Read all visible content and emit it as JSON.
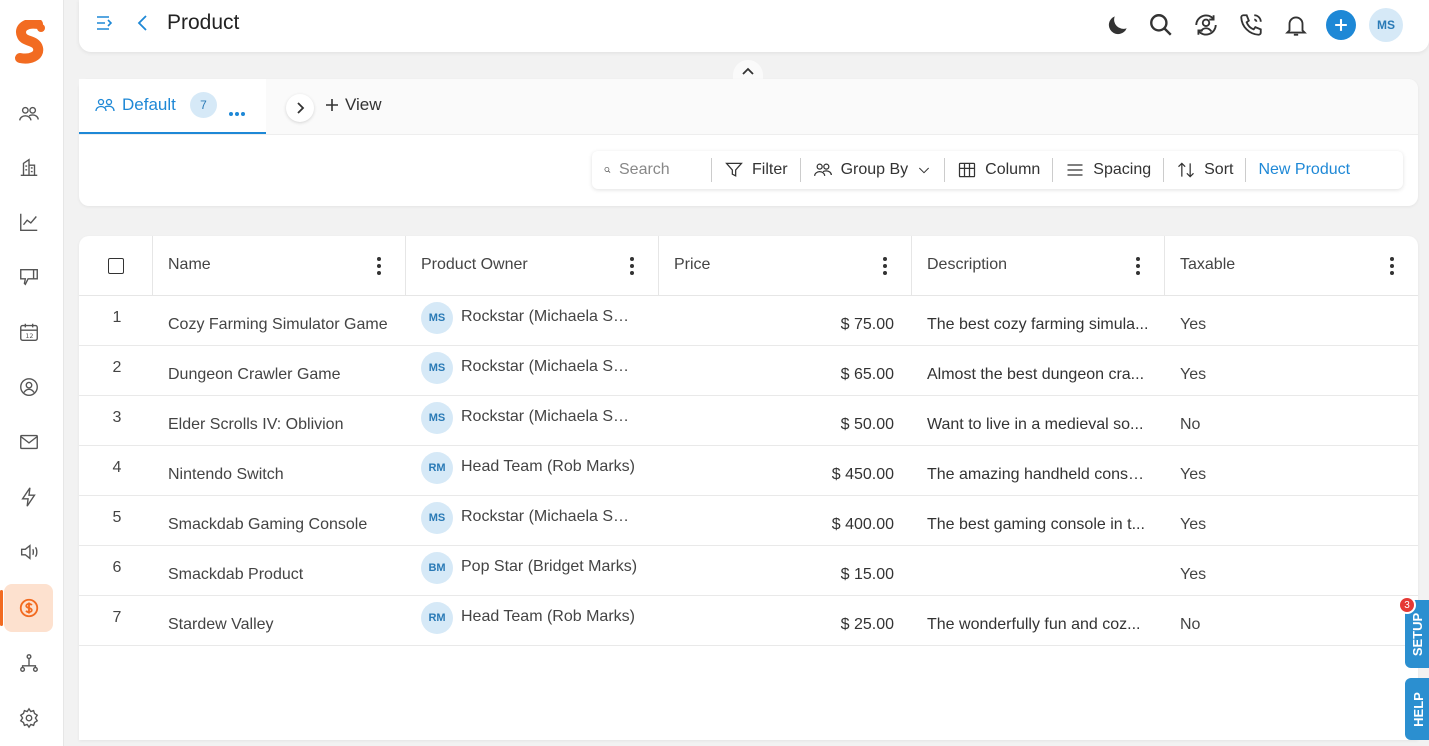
{
  "header": {
    "title": "Product",
    "user_initials": "MS",
    "icons": [
      "menu-toggle-icon",
      "back-icon",
      "moon-icon",
      "search-icon",
      "sync-user-icon",
      "phone-icon",
      "bell-icon",
      "plus-icon"
    ]
  },
  "sidebar": {
    "items": [
      {
        "icon": "contacts-icon"
      },
      {
        "icon": "building-icon"
      },
      {
        "icon": "chart-icon"
      },
      {
        "icon": "thumbs-down-icon"
      },
      {
        "icon": "calendar-icon"
      },
      {
        "icon": "user-circle-icon"
      },
      {
        "icon": "mail-icon"
      },
      {
        "icon": "lightning-icon"
      },
      {
        "icon": "speaker-icon"
      },
      {
        "icon": "dollar-icon",
        "active": true
      },
      {
        "icon": "hierarchy-icon"
      },
      {
        "icon": "settings-icon"
      }
    ],
    "active_color": "#f26b21"
  },
  "views": {
    "default_label": "Default",
    "default_count": "7",
    "add_view_label": "View"
  },
  "toolbar": {
    "search_placeholder": "Search",
    "filter": "Filter",
    "group_by": "Group By",
    "column": "Column",
    "spacing": "Spacing",
    "sort": "Sort",
    "new_product": "New Product"
  },
  "table": {
    "columns": [
      "Name",
      "Product Owner",
      "Price",
      "Description",
      "Taxable"
    ],
    "rows": [
      {
        "idx": "1",
        "name": "Cozy Farming Simulator Game",
        "owner_initials": "MS",
        "owner": "Rockstar (Michaela Smi...",
        "price": "$ 75.00",
        "desc": "The best cozy farming simula...",
        "taxable": "Yes"
      },
      {
        "idx": "2",
        "name": "Dungeon Crawler Game",
        "owner_initials": "MS",
        "owner": "Rockstar (Michaela Smi...",
        "price": "$ 65.00",
        "desc": "Almost the best dungeon cra...",
        "taxable": "Yes"
      },
      {
        "idx": "3",
        "name": "Elder Scrolls IV: Oblivion",
        "owner_initials": "MS",
        "owner": "Rockstar (Michaela Smi...",
        "price": "$ 50.00",
        "desc": "Want to live in a medieval so...",
        "taxable": "No"
      },
      {
        "idx": "4",
        "name": "Nintendo Switch",
        "owner_initials": "RM",
        "owner": "Head Team (Rob Marks)",
        "price": "$ 450.00",
        "desc": "The amazing handheld conso...",
        "taxable": "Yes"
      },
      {
        "idx": "5",
        "name": "Smackdab Gaming Console",
        "owner_initials": "MS",
        "owner": "Rockstar (Michaela Smi...",
        "price": "$ 400.00",
        "desc": "The best gaming console in t...",
        "taxable": "Yes"
      },
      {
        "idx": "6",
        "name": "Smackdab Product",
        "owner_initials": "BM",
        "owner": "Pop Star (Bridget Marks)",
        "price": "$ 15.00",
        "desc": "",
        "taxable": "Yes"
      },
      {
        "idx": "7",
        "name": "Stardew Valley",
        "owner_initials": "RM",
        "owner": "Head Team (Rob Marks)",
        "price": "$ 25.00",
        "desc": "The wonderfully fun and coz...",
        "taxable": "No"
      }
    ]
  },
  "side_tabs": {
    "setup": "SETUP",
    "setup_badge": "3",
    "help": "HELP"
  }
}
